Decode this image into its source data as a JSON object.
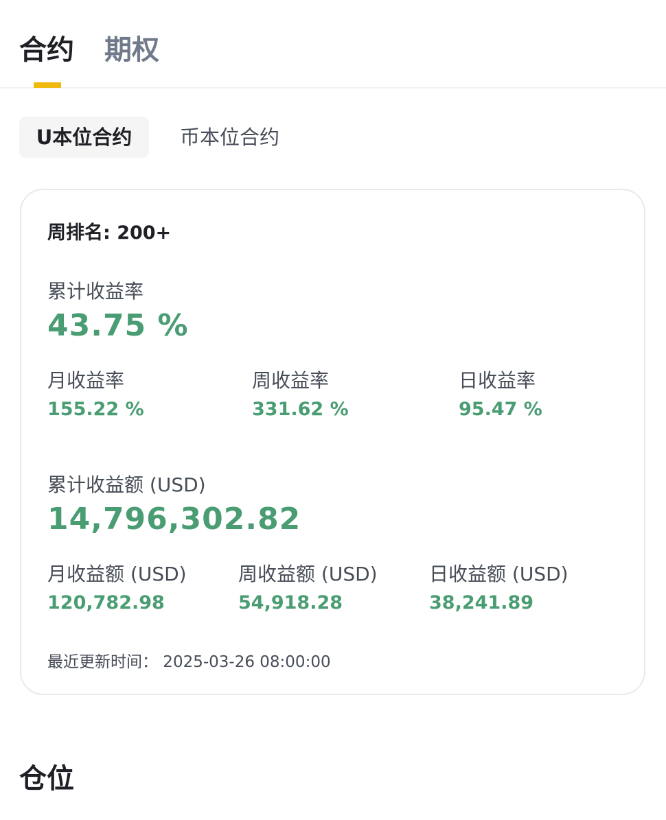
{
  "top_tabs": {
    "contract": "合约",
    "options": "期权"
  },
  "sub_tabs": {
    "usdt_m": "U本位合约",
    "coin_m": "币本位合约"
  },
  "card": {
    "weekly_rank": "周排名: 200+",
    "cumulative_roi_label": "累计收益率",
    "cumulative_roi_value": "43.75 %",
    "monthly_roi_label": "月收益率",
    "monthly_roi_value": "155.22 %",
    "weekly_roi_label": "周收益率",
    "weekly_roi_value": "331.62 %",
    "daily_roi_label": "日收益率",
    "daily_roi_value": "95.47 %",
    "cumulative_pnl_label": "累计收益额 (USD)",
    "cumulative_pnl_value": "14,796,302.82",
    "monthly_pnl_label": "月收益额 (USD)",
    "monthly_pnl_value": "120,782.98",
    "weekly_pnl_label": "周收益额 (USD)",
    "weekly_pnl_value": "54,918.28",
    "daily_pnl_label": "日收益额 (USD)",
    "daily_pnl_value": "38,241.89",
    "last_updated": "最近更新时间： 2025-03-26 08:00:00"
  },
  "positions_title": "仓位",
  "colors": {
    "accent": "#f0b90b",
    "positive": "#4a9d72",
    "text_primary": "#1e2026",
    "text_secondary": "#474d57"
  }
}
